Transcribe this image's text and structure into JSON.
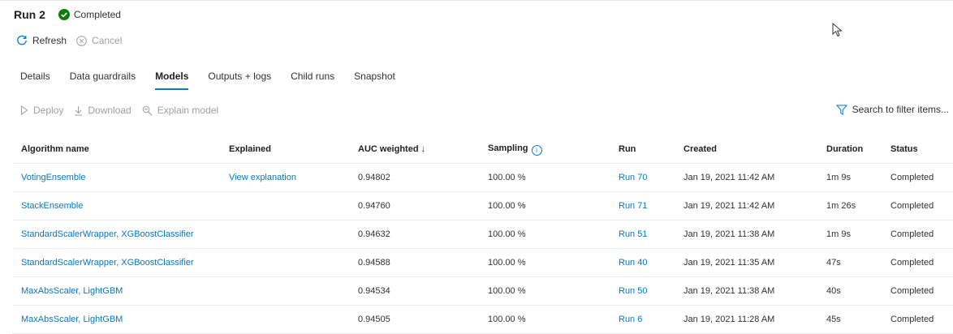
{
  "header": {
    "title": "Run 2",
    "status": "Completed"
  },
  "commands": {
    "refresh": "Refresh",
    "cancel": "Cancel"
  },
  "tabs": [
    {
      "label": "Details"
    },
    {
      "label": "Data guardrails"
    },
    {
      "label": "Models",
      "active": true
    },
    {
      "label": "Outputs + logs"
    },
    {
      "label": "Child runs"
    },
    {
      "label": "Snapshot"
    }
  ],
  "toolbar": {
    "deploy": "Deploy",
    "download": "Download",
    "explain": "Explain model",
    "filter": "Search to filter items..."
  },
  "table": {
    "columns": {
      "algorithm": "Algorithm name",
      "explained": "Explained",
      "auc": "AUC weighted",
      "auc_sort": "↓",
      "sampling": "Sampling",
      "run": "Run",
      "created": "Created",
      "duration": "Duration",
      "status": "Status"
    },
    "rows": [
      {
        "algorithm": "VotingEnsemble",
        "explained": "View explanation",
        "auc": "0.94802",
        "sampling": "100.00 %",
        "run": "Run 70",
        "created": "Jan 19, 2021 11:42 AM",
        "duration": "1m 9s",
        "status": "Completed"
      },
      {
        "algorithm": "StackEnsemble",
        "explained": "",
        "auc": "0.94760",
        "sampling": "100.00 %",
        "run": "Run 71",
        "created": "Jan 19, 2021 11:42 AM",
        "duration": "1m 26s",
        "status": "Completed"
      },
      {
        "algorithm": "StandardScalerWrapper, XGBoostClassifier",
        "explained": "",
        "auc": "0.94632",
        "sampling": "100.00 %",
        "run": "Run 51",
        "created": "Jan 19, 2021 11:38 AM",
        "duration": "1m 9s",
        "status": "Completed"
      },
      {
        "algorithm": "StandardScalerWrapper, XGBoostClassifier",
        "explained": "",
        "auc": "0.94588",
        "sampling": "100.00 %",
        "run": "Run 40",
        "created": "Jan 19, 2021 11:35 AM",
        "duration": "47s",
        "status": "Completed"
      },
      {
        "algorithm": "MaxAbsScaler, LightGBM",
        "explained": "",
        "auc": "0.94534",
        "sampling": "100.00 %",
        "run": "Run 50",
        "created": "Jan 19, 2021 11:38 AM",
        "duration": "40s",
        "status": "Completed"
      },
      {
        "algorithm": "MaxAbsScaler, LightGBM",
        "explained": "",
        "auc": "0.94505",
        "sampling": "100.00 %",
        "run": "Run 6",
        "created": "Jan 19, 2021 11:28 AM",
        "duration": "45s",
        "status": "Completed"
      }
    ]
  },
  "colors": {
    "accent": "#0078d4",
    "success": "#107c10",
    "disabled": "#a19f9d"
  },
  "icons": {
    "status": "check-circle-icon",
    "refresh": "refresh-icon",
    "cancel": "cancel-icon",
    "deploy": "play-icon",
    "download": "download-icon",
    "explain": "explain-icon",
    "filter": "filter-icon",
    "info": "info-icon"
  }
}
